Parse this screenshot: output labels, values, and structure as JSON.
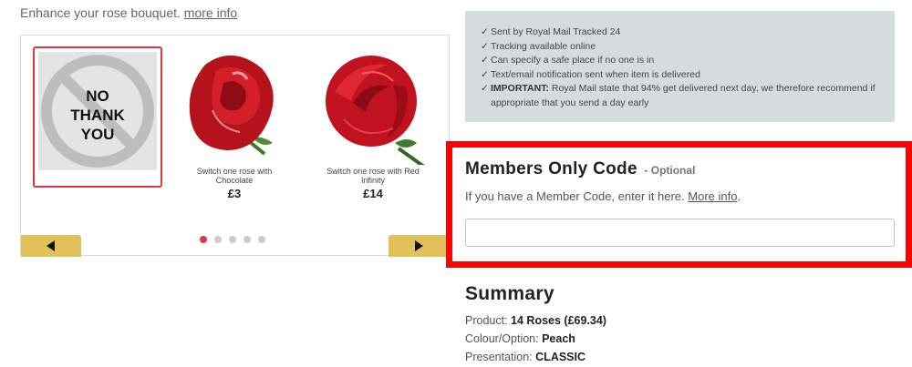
{
  "intro": {
    "text": "Enhance your rose bouquet.",
    "link": "more info"
  },
  "carousel": {
    "no_thanks": "NO\nTHANK\nYOU",
    "products": [
      {
        "label": "Switch one rose with Chocolate",
        "price": "£3"
      },
      {
        "label": "Switch one rose with Red Infinity",
        "price": "£14"
      }
    ],
    "dots": 5,
    "active_dot": 0
  },
  "delivery": {
    "lines": [
      {
        "text": "Sent by Royal Mail Tracked 24"
      },
      {
        "text": "Tracking available online"
      },
      {
        "text": "Can specify a safe place if no one is in"
      },
      {
        "text": "Text/email notification sent when item is delivered"
      },
      {
        "strong": "IMPORTANT:",
        "text": " Royal Mail state that 94% get delivered next day, we therefore recommend if appropriate that you send a day early"
      }
    ]
  },
  "members": {
    "title": "Members Only Code",
    "optional": "- Optional",
    "desc": "If you have a Member Code, enter it here.",
    "more_info": "More info",
    "input_value": "",
    "input_placeholder": ""
  },
  "summary": {
    "title": "Summary",
    "rows": [
      {
        "label": "Product:",
        "value": "14 Roses (£69.34)"
      },
      {
        "label": "Colour/Option:",
        "value": "Peach"
      },
      {
        "label": "Presentation:",
        "value": "CLASSIC"
      }
    ]
  },
  "colors": {
    "accent_red": "#d9383e",
    "highlight": "#ff0000",
    "nav_gold": "#e1c25a",
    "info_bg": "#d6dbdd"
  }
}
